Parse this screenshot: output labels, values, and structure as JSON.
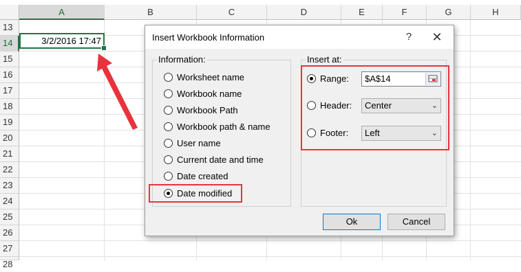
{
  "sheet": {
    "columns": [
      "A",
      "B",
      "C",
      "D",
      "E",
      "F",
      "G",
      "H"
    ],
    "rows": [
      "13",
      "14",
      "15",
      "16",
      "17",
      "18",
      "19",
      "20",
      "21",
      "22",
      "23",
      "24",
      "25",
      "26",
      "27",
      "28"
    ],
    "active_cell_value": "3/2/2016 17:47",
    "colors": {
      "accent": "#217346",
      "highlight": "#e8333d"
    }
  },
  "dialog": {
    "title": "Insert Workbook Information",
    "help_glyph": "?",
    "close_glyph": "✕",
    "information": {
      "label": "Information:",
      "options": [
        {
          "label": "Worksheet name",
          "selected": false
        },
        {
          "label": "Workbook name",
          "selected": false
        },
        {
          "label": "Workbook Path",
          "selected": false
        },
        {
          "label": "Workbook path & name",
          "selected": false
        },
        {
          "label": "User name",
          "selected": false
        },
        {
          "label": "Current date and time",
          "selected": false
        },
        {
          "label": "Date created",
          "selected": false
        },
        {
          "label": "Date modified",
          "selected": true
        }
      ]
    },
    "insert_at": {
      "label": "Insert at:",
      "range_label": "Range:",
      "range_value": "$A$14",
      "header_label": "Header:",
      "header_value": "Center",
      "footer_label": "Footer:",
      "footer_value": "Left",
      "selected": "range"
    },
    "ok_label": "Ok",
    "cancel_label": "Cancel"
  }
}
